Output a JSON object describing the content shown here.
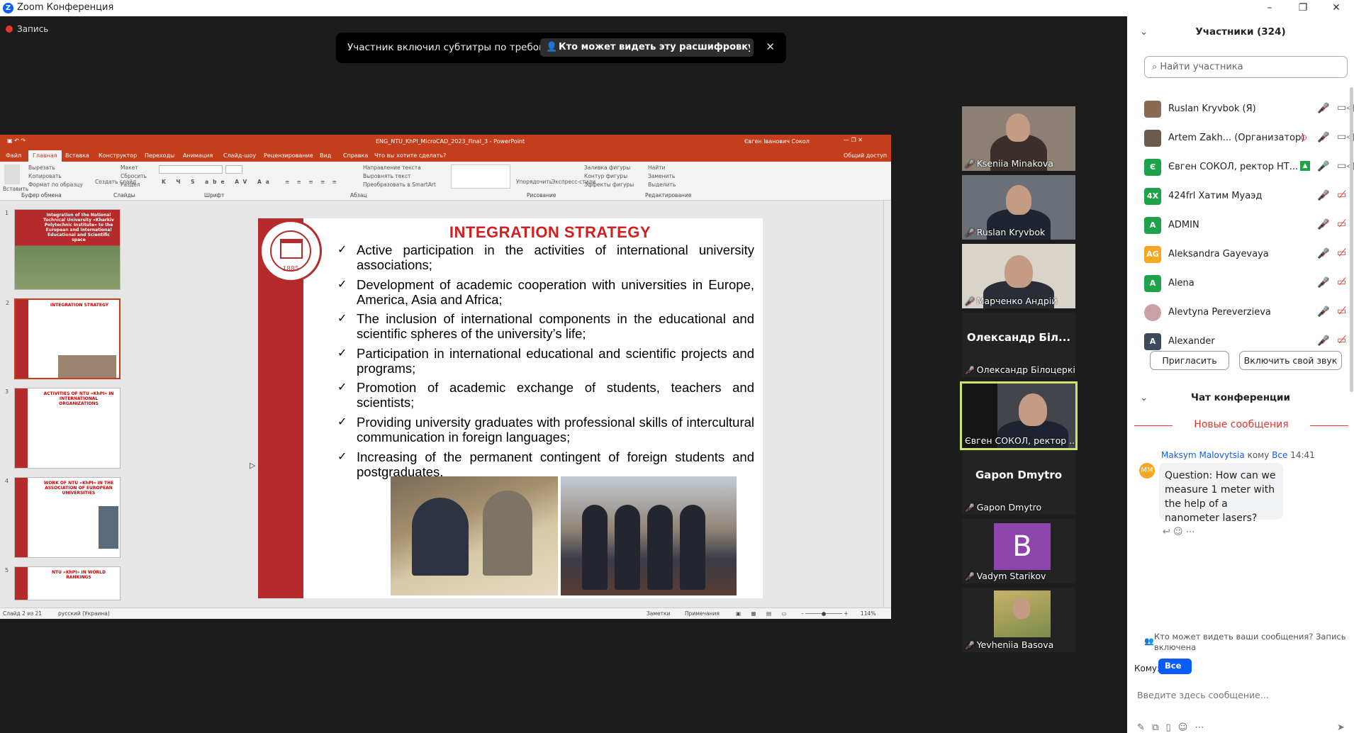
{
  "window": {
    "title": "Zoom Конференция",
    "logo": "Z"
  },
  "recording": {
    "label": "Запись"
  },
  "notice": {
    "text": "Участник включил субтитры по требованию",
    "link": "Кто может видеть эту расшифровку? За...",
    "close": "✕"
  },
  "ppt": {
    "file_title": "ENG_NTU_KhPI_MicroCAD_2023_Final_3  -  PowerPoint",
    "user": "Євген Іванович Сокол",
    "tabs": [
      "Файл",
      "Главная",
      "Вставка",
      "Конструктор",
      "Переходы",
      "Анимация",
      "Слайд-шоу",
      "Рецензирование",
      "Вид",
      "Справка"
    ],
    "active_tab": "Главная",
    "tell_me": "Что вы хотите сделать?",
    "share": "Общий доступ",
    "ribbon_groups": [
      "Буфер обмена",
      "Слайды",
      "Шрифт",
      "Абзац",
      "Рисование",
      "Редактирование"
    ],
    "ribbon_items": {
      "insert": "Вставить",
      "cut": "Вырезать",
      "copy": "Копировать",
      "format": "Формат по образцу",
      "create": "Создать слайд",
      "layout": "Макет",
      "reset": "Сбросить",
      "section": "Раздел",
      "textdir": "Направление текста",
      "align": "Выровнять текст",
      "smartart": "Преобразовать в SmartArt",
      "arrange": "Упорядочить",
      "styles": "Экспресс-стили",
      "fill": "Заливка фигуры",
      "outline": "Контур фигуры",
      "effects": "Эффекты фигуры",
      "find": "Найти",
      "replace": "Заменить",
      "select": "Выделить"
    },
    "thumbs": [
      {
        "num": "1",
        "title": "Integration of the National Technical University «Kharkiv Polytechnic Institute» to the European and International Educational and Scientific space"
      },
      {
        "num": "2",
        "title": "INTEGRATION STRATEGY"
      },
      {
        "num": "3",
        "title": "ACTIVITIES OF NTU «KhPI» IN INTERNATIONAL ORGANIZATIONS"
      },
      {
        "num": "4",
        "title": "WORK OF NTU «KhPI» IN THE ASSOCIATION OF EUROPEAN UNIVERSITIES"
      },
      {
        "num": "5",
        "title": "NTU «KhPI» IN WORLD RANKINGS"
      }
    ],
    "slide": {
      "title": "INTEGRATION STRATEGY",
      "seal_year": "1885",
      "bullets": [
        "Active participation in the activities of international university associations;",
        "Development of academic cooperation with universities in Europe, America, Asia and Africa;",
        "The inclusion of international components in the educational and scientific spheres of the university’s life;",
        "Participation in international educational and scientific projects and programs;",
        "Promotion of academic exchange of students, teachers and scientists;",
        "Providing university graduates with professional skills of intercultural communication in foreign languages;",
        "Increasing of the permanent contingent of foreign students and postgraduates."
      ]
    },
    "status": {
      "slide": "Слайд 2 из 21",
      "lang": "русский (Украина)",
      "notes": "Заметки",
      "comments": "Примечания",
      "zoom": "114%"
    }
  },
  "tiles": [
    {
      "name": "Kseniia Minakova"
    },
    {
      "name": "Ruslan Kryvbok"
    },
    {
      "name": "Марченко Андрій"
    },
    {
      "big": "Олександр  Біл...",
      "name": "Олександр Білоцеркі..."
    },
    {
      "name": "Євген СОКОЛ, ректор ..."
    },
    {
      "big": "Gapon Dmytro",
      "name": "Gapon Dmytro"
    },
    {
      "letter": "B",
      "name": "Vadym Starikov"
    },
    {
      "name": "Yevheniia Basova"
    }
  ],
  "participants": {
    "title": "Участники (324)",
    "search_placeholder": "Найти участника",
    "list": [
      {
        "initials": "",
        "name": "Ruslan Kryvbok (Я)",
        "color": "#8a6a55"
      },
      {
        "initials": "",
        "name": "Artem Zakh... (Организатор)",
        "color": "#6b5b4e"
      },
      {
        "initials": "Є",
        "name": "Євген СОКОЛ, ректор НТ...",
        "color": "#1fa34a"
      },
      {
        "initials": "4X",
        "name": "424frl Хатим Муаэд",
        "color": "#1fa34a"
      },
      {
        "initials": "A",
        "name": "ADMIN",
        "color": "#1fa34a"
      },
      {
        "initials": "AG",
        "name": "Aleksandra Gayevaya",
        "color": "#f5a623"
      },
      {
        "initials": "A",
        "name": "Alena",
        "color": "#1fa34a"
      },
      {
        "initials": "",
        "name": "Alevtyna Pereverzieva",
        "color": "#c9a0a8"
      },
      {
        "initials": "A",
        "name": "Alexander",
        "color": "#3c4a5c"
      }
    ],
    "invite": "Пригласить",
    "unmute": "Включить свой звук"
  },
  "chat": {
    "title": "Чат конференции",
    "new_messages": "Новые сообщения",
    "msg_sender": "Maksym Malovytsia",
    "msg_to": "кому",
    "msg_target": "Все",
    "msg_time": "14:41",
    "msg_avatar": "MM",
    "msg_text": "Question: How can we measure 1 meter with the help of a nanometer lasers?",
    "privacy_note": "Кто может видеть ваши сообщения? Запись включена",
    "to_label": "Кому:",
    "to_value": "Все",
    "input_placeholder": "Введите здесь сообщение..."
  },
  "colors": {
    "accent": "#0b5cff",
    "ppt_red": "#c43e1c",
    "mute_red": "#e8352b",
    "active_speaker": "#c9e56f"
  }
}
